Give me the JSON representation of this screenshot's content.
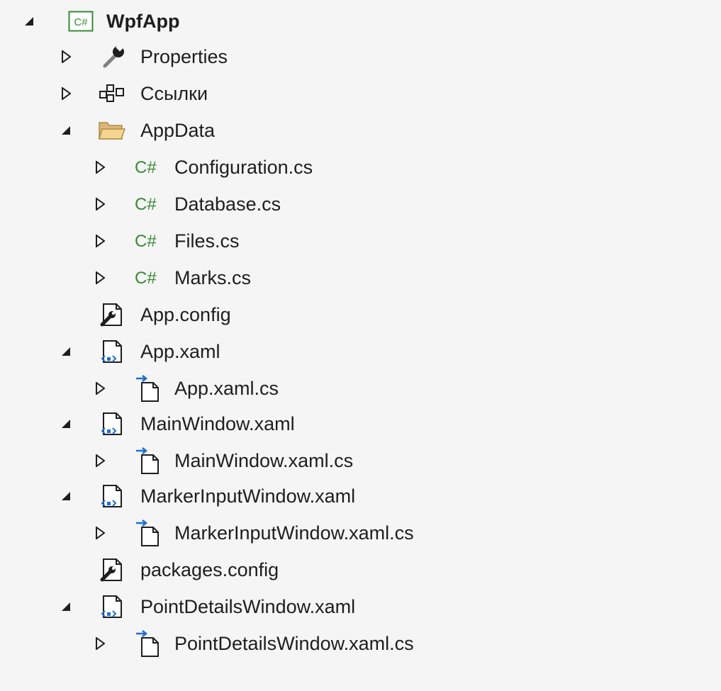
{
  "tree": {
    "project": {
      "label": "WpfApp",
      "badge": "C#"
    },
    "properties": {
      "label": "Properties"
    },
    "references": {
      "label": "Ссылки"
    },
    "appdata": {
      "label": "AppData",
      "files": [
        {
          "label": "Configuration.cs",
          "badge": "C#"
        },
        {
          "label": "Database.cs",
          "badge": "C#"
        },
        {
          "label": "Files.cs",
          "badge": "C#"
        },
        {
          "label": "Marks.cs",
          "badge": "C#"
        }
      ]
    },
    "app_config": {
      "label": "App.config"
    },
    "app_xaml": {
      "label": "App.xaml",
      "code": "App.xaml.cs"
    },
    "main_window": {
      "label": "MainWindow.xaml",
      "code": "MainWindow.xaml.cs"
    },
    "marker_input_window": {
      "label": "MarkerInputWindow.xaml",
      "code": "MarkerInputWindow.xaml.cs"
    },
    "packages_config": {
      "label": "packages.config"
    },
    "point_details_window": {
      "label": "PointDetailsWindow.xaml",
      "code": "PointDetailsWindow.xaml.cs"
    }
  },
  "colors": {
    "csharp_green": "#388a34",
    "folder_yellow": "#dcb67a",
    "xaml_blue": "#1f6fd0",
    "background": "#f5f5f5"
  }
}
